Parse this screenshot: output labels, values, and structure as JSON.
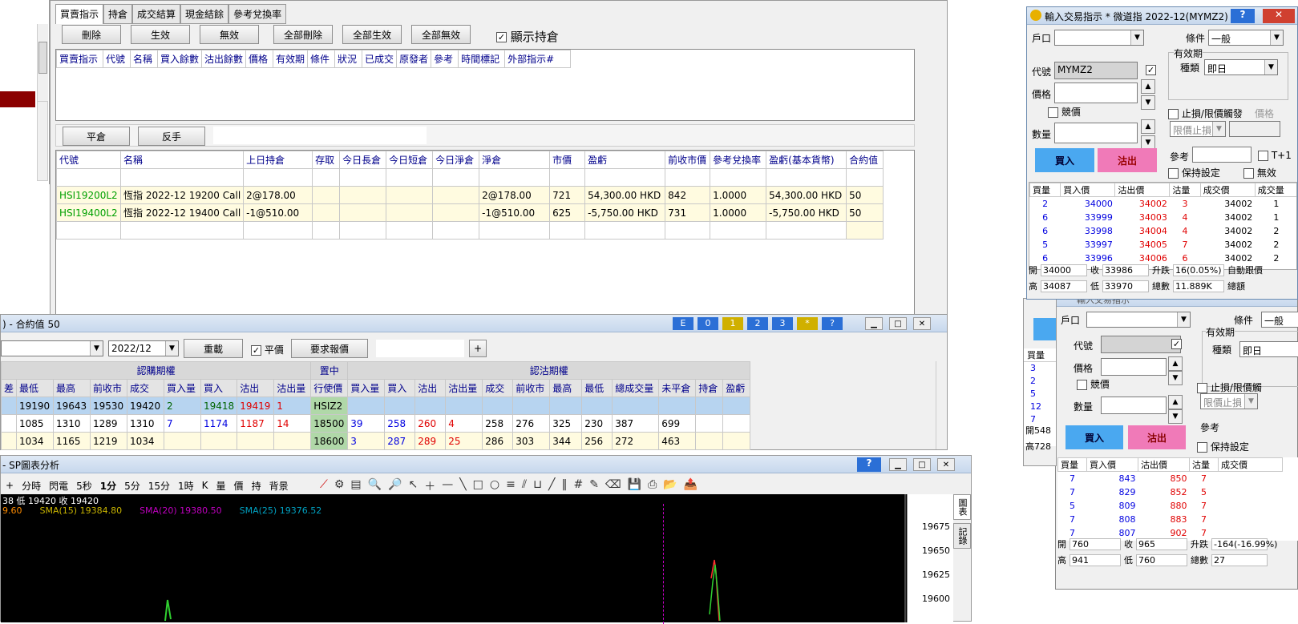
{
  "orders": {
    "tabs": [
      "買賣指示",
      "持倉",
      "成交結算",
      "現金結餘",
      "參考兌換率"
    ],
    "buttons": {
      "delete": "刪除",
      "activate": "生效",
      "deactivate": "無效",
      "delete_all": "全部刪除",
      "activate_all": "全部生效",
      "deactivate_all": "全部無效"
    },
    "show_positions": "顯示持倉",
    "columns": [
      "買賣指示",
      "代號",
      "名稱",
      "買入餘數",
      "沽出餘數",
      "價格",
      "有效期",
      "條件",
      "狀況",
      "已成交",
      "原發者",
      "參考",
      "時間標記",
      "外部指示#"
    ]
  },
  "positions": {
    "close_button": "平倉",
    "reverse_button": "反手",
    "columns": [
      "代號",
      "名稱",
      "上日持倉",
      "存取",
      "今日長倉",
      "今日短倉",
      "今日淨倉",
      "淨倉",
      "市價",
      "盈虧",
      "前收市價",
      "參考兌換率",
      "盈虧(基本貨幣)",
      "合約值"
    ],
    "rows": [
      [
        "HSI19200L2",
        "恆指 2022-12 19200 Call",
        "2@178.00",
        "",
        "",
        "",
        "",
        "2@178.00",
        "721",
        "54,300.00 HKD",
        "842",
        "1.0000",
        "54,300.00 HKD",
        "50"
      ],
      [
        "HSI19400L2",
        "恆指 2022-12 19400 Call",
        "-1@510.00",
        "",
        "",
        "",
        "",
        "-1@510.00",
        "625",
        "-5,750.00 HKD",
        "731",
        "1.0000",
        "-5,750.00 HKD",
        "50"
      ]
    ]
  },
  "options": {
    "title": ") - 合約值 50",
    "toolbar_buttons": [
      "E",
      "0",
      "1",
      "2",
      "3",
      "*",
      "?"
    ],
    "month": "2022/12",
    "reload": "重載",
    "flat_price": "平價",
    "request_quote": "要求報價",
    "plus": "+",
    "call_header": "認購期權",
    "mid_header": "置中",
    "put_header": "認沽期權",
    "call_columns": [
      "差",
      "最低",
      "最高",
      "前收市",
      "成交",
      "買入量",
      "買入",
      "沽出",
      "沽出量"
    ],
    "strike_column": "行使價",
    "put_columns": [
      "買入量",
      "買入",
      "沽出",
      "沽出量",
      "成交",
      "前收市",
      "最高",
      "最低",
      "總成交量",
      "未平倉",
      "持倉",
      "盈虧"
    ],
    "rows": [
      {
        "call": [
          "",
          "19190",
          "19643",
          "19530",
          "19420",
          "2",
          "19418",
          "19419",
          "1"
        ],
        "strike": "HSIZ2",
        "put": [
          "",
          "",
          "",
          "",
          "",
          "",
          "",
          "",
          "",
          "",
          "",
          ""
        ]
      },
      {
        "call": [
          "",
          "1085",
          "1310",
          "1289",
          "1310",
          "7",
          "1174",
          "1187",
          "14"
        ],
        "strike": "18500",
        "put": [
          "39",
          "258",
          "260",
          "4",
          "258",
          "276",
          "325",
          "230",
          "387",
          "699",
          "",
          ""
        ]
      },
      {
        "call": [
          "",
          "1034",
          "1165",
          "1219",
          "1034",
          "",
          "",
          "",
          "",
          ""
        ],
        "strike": "18600",
        "put": [
          "3",
          "287",
          "289",
          "25",
          "286",
          "303",
          "344",
          "256",
          "272",
          "463",
          "",
          ""
        ]
      }
    ]
  },
  "chart": {
    "title": "- SP圖表分析",
    "toolbar": [
      "+",
      "分時",
      "閃電",
      "5秒",
      "1分",
      "5分",
      "15分",
      "1時",
      "K",
      "量",
      "價",
      "持",
      "背景"
    ],
    "info_line": "38 低 19420 收 19420",
    "sma": [
      {
        "label": "9.60",
        "color": "#ff8c00"
      },
      {
        "label": "SMA(15) 19384.80",
        "color": "#c8b400"
      },
      {
        "label": "SMA(20) 19380.50",
        "color": "#c000c0"
      },
      {
        "label": "SMA(25) 19376.52",
        "color": "#00a0c0"
      }
    ],
    "y_ticks": [
      "19675",
      "19650",
      "19625",
      "19600"
    ],
    "side_tabs": [
      "圖表",
      "記錄"
    ]
  },
  "order1": {
    "title": "輸入交易指示 * 微道指 2022-12(MYMZ2)",
    "account_label": "戶口",
    "condition_label": "條件",
    "condition_value": "一般",
    "validity_label": "有效期",
    "type_label": "種類",
    "type_value": "即日",
    "code_label": "代號",
    "code_value": "MYMZ2",
    "price_label": "價格",
    "bid_label": "競價",
    "stop_label": "止損/限價觸發",
    "price_hint": "價格",
    "stop_type": "限價止損",
    "qty_label": "數量",
    "ref_label": "參考",
    "t1_label": "T+1",
    "buy": "買入",
    "sell": "沽出",
    "keep_label": "保持設定",
    "invalid_label": "無效",
    "depth_columns": [
      "買量",
      "買入價",
      "沽出價",
      "沽量",
      "成交價",
      "成交量"
    ],
    "depth": [
      [
        "2",
        "34000",
        "34002",
        "3",
        "34002",
        "1"
      ],
      [
        "6",
        "33999",
        "34003",
        "4",
        "34002",
        "1"
      ],
      [
        "6",
        "33998",
        "34004",
        "4",
        "34002",
        "2"
      ],
      [
        "5",
        "33997",
        "34005",
        "7",
        "34002",
        "2"
      ],
      [
        "6",
        "33996",
        "34006",
        "6",
        "34002",
        "2"
      ]
    ],
    "stats": {
      "open_label": "開",
      "open": "34000",
      "close_label": "收",
      "close": "33986",
      "chg_label": "升跌",
      "chg": "16(0.05%)",
      "auto_label": "自動跟價",
      "high_label": "高",
      "high": "34087",
      "low_label": "低",
      "low": "33970",
      "vol_label": "總數",
      "vol": "11.889K",
      "total_label": "總額"
    }
  },
  "order2": {
    "title": "輸入交易指示",
    "account_label": "戶口",
    "condition_label": "條件",
    "condition_value": "一般",
    "validity_label": "有效期",
    "type_label": "種類",
    "type_value": "即日",
    "code_label": "代號",
    "price_label": "價格",
    "bid_label": "競價",
    "stop_label": "止損/限價觸",
    "stop_type": "限價止損",
    "qty_label": "數量",
    "ref_label": "參考",
    "buy": "買入",
    "sell": "沽出",
    "keep_label": "保持設定",
    "depth_columns": [
      "買量",
      "買入價",
      "沽出價",
      "沽量",
      "成交價"
    ],
    "depth": [
      [
        "7",
        "843",
        "850",
        "7"
      ],
      [
        "7",
        "829",
        "852",
        "5"
      ],
      [
        "5",
        "809",
        "880",
        "7"
      ],
      [
        "7",
        "808",
        "883",
        "7"
      ],
      [
        "7",
        "807",
        "902",
        "7"
      ]
    ],
    "stats": {
      "open_label": "開",
      "open": "760",
      "close_label": "收",
      "close": "965",
      "chg_label": "升跌",
      "chg": "-164(-16.99%)",
      "high_label": "高",
      "high": "941",
      "low_label": "低",
      "low": "760",
      "vol_label": "總數",
      "vol": "27"
    },
    "bg_left": {
      "qty_header": "買量",
      "qtys": [
        "3",
        "2",
        "5",
        "12",
        "7"
      ],
      "open_label": "開",
      "open": "548",
      "high_label": "高",
      "high": "728"
    }
  }
}
